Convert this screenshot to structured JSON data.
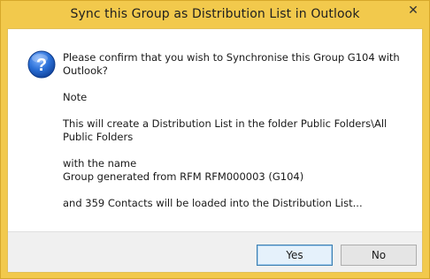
{
  "window": {
    "title": "Sync this Group as Distribution List in Outlook",
    "close_glyph": "✕"
  },
  "icon": {
    "name": "question-icon",
    "glyph": "?",
    "color": "#1f5fbf"
  },
  "message": {
    "line1": "Please confirm that you wish to Synchronise this Group G104 with Outlook?",
    "line2": "Note",
    "line3": "This will create a Distribution List in the folder Public Folders\\All Public Folders",
    "line4a": "with the name",
    "line4b": "Group generated from RFM RFM000003 (G104)",
    "line5": "and 359 Contacts will be loaded into the Distribution List..."
  },
  "buttons": {
    "yes": "Yes",
    "no": "No"
  }
}
